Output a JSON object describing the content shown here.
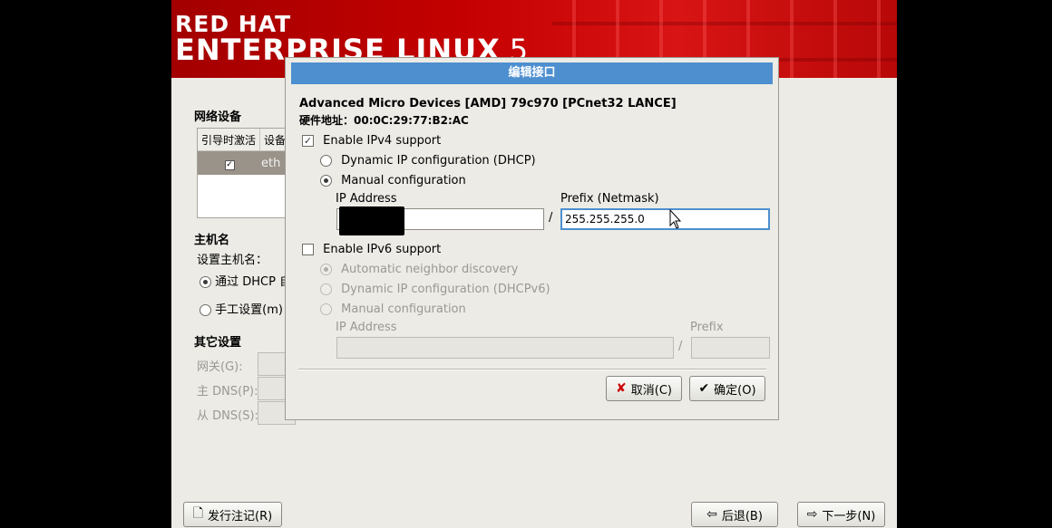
{
  "banner": {
    "line1": "RED HAT",
    "line2": "ENTERPRISE LINUX",
    "version": "5"
  },
  "background": {
    "network_devices_label": "网络设备",
    "device_table": {
      "columns": [
        "引导时激活",
        "设备"
      ],
      "rows": [
        {
          "active": true,
          "device": "eth"
        }
      ]
    },
    "hostname_label": "主机名",
    "set_hostname_label": "设置主机名：",
    "hostname_options": [
      {
        "label": "通过 DHCP 自",
        "selected": true
      },
      {
        "label": "手工设置(m)",
        "selected": false
      }
    ],
    "other_settings_label": "其它设置",
    "gateway_label": "网关(G):",
    "primary_dns_label": "主 DNS(P):",
    "secondary_dns_label": "从 DNS(S):",
    "release_notes_button": "发行注记(R)",
    "back_button": "后退(B)",
    "next_button": "下一步(N)"
  },
  "dialog": {
    "title": "编辑接口",
    "device_name": "Advanced Micro Devices [AMD] 79c970 [PCnet32 LANCE]",
    "hw_address": "硬件地址：00:0C:29:77:B2:AC",
    "ipv4": {
      "enable_label": "Enable IPv4 support",
      "enabled": true,
      "dhcp_label": "Dynamic IP configuration (DHCP)",
      "manual_label": "Manual configuration",
      "mode": "manual",
      "ip_label": "IP Address",
      "ip_value": "",
      "slash": "/",
      "prefix_label": "Prefix (Netmask)",
      "prefix_value": "255.255.255.0"
    },
    "ipv6": {
      "enable_label": "Enable IPv6 support",
      "enabled": false,
      "auto_label": "Automatic neighbor discovery",
      "dhcp_label": "Dynamic IP configuration (DHCPv6)",
      "manual_label": "Manual configuration",
      "mode": "auto",
      "ip_label": "IP Address",
      "slash": "/",
      "prefix_label": "Prefix"
    },
    "cancel_button": "取消(C)",
    "ok_button": "确定(O)"
  },
  "colors": {
    "title_bar": "#4e8fcf",
    "banner": "#c40000",
    "window_bg": "#ecebe6"
  }
}
